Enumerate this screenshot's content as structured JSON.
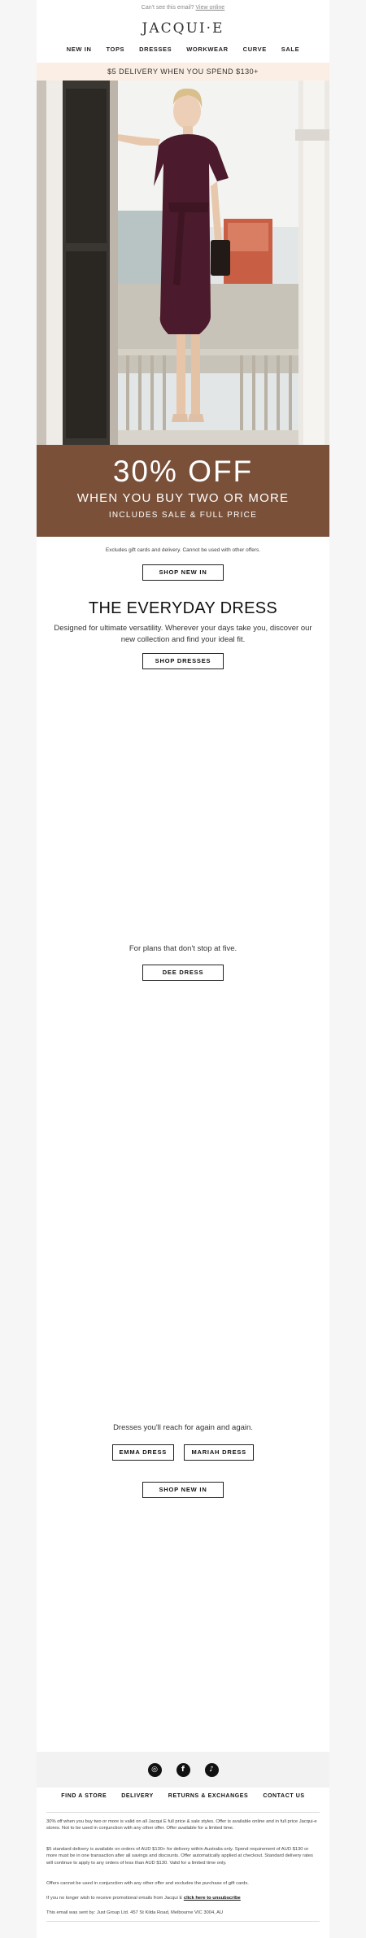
{
  "preheader": {
    "text": "Can't see this email?",
    "link": "View online"
  },
  "brand": {
    "logo": "JACQUI·E"
  },
  "nav": [
    "NEW IN",
    "TOPS",
    "DRESSES",
    "WORKWEAR",
    "CURVE",
    "SALE"
  ],
  "promo_bar": "$5 DELIVERY WHEN YOU SPEND $130+",
  "offer": {
    "headline": "30% OFF",
    "sub": "WHEN YOU BUY TWO OR MORE",
    "small": "INCLUDES SALE & FULL PRICE",
    "note": "Excludes gift cards and delivery. Cannot be used with other offers.",
    "cta": "SHOP NEW IN"
  },
  "everyday": {
    "title": "THE EVERYDAY DRESS",
    "body": "Designed for ultimate versatility. Wherever your days take you, discover our new collection and find your ideal fit.",
    "cta": "SHOP DRESSES"
  },
  "dee": {
    "tagline": "For plans that don't stop at five.",
    "cta": "DEE DRESS"
  },
  "emma": {
    "tagline": "Dresses you'll reach for again and again.",
    "cta_left": "EMMA DRESS",
    "cta_right": "MARIAH DRESS",
    "cta_bottom": "SHOP NEW IN"
  },
  "social": [
    {
      "icon": "instagram-icon",
      "glyph": "◎"
    },
    {
      "icon": "facebook-icon",
      "glyph": "f"
    },
    {
      "icon": "tiktok-icon",
      "glyph": "♪"
    }
  ],
  "footer_nav": [
    "FIND A STORE",
    "DELIVERY",
    "RETURNS & EXCHANGES",
    "CONTACT US"
  ],
  "legal": {
    "p1": "30% off when you buy two or more is valid on all Jacqui E full price & sale styles. Offer is available online and in full price Jacqui-e stores. Not to be used in conjunction with any other offer. Offer available for a limited time.",
    "p2": "$5 standard delivery is available on orders of AUD $130+ for delivery within Australia only. Spend requirement of AUD $130 or more must be in one transaction after all savings and discounts. Offer automatically applied at checkout. Standard delivery rates will continue to apply to any orders of less than AUD $130. Valid for a limited time only.",
    "p3": "Offers cannot be used in conjunction with any other offer and excludes the purchase of gift cards.",
    "unsub_text": "If you no longer wish to receive promotional emails from Jacqui E",
    "unsub_link": "click here to unsubscribe",
    "sent_by": "This email was sent by: Just Group Ltd. 457 St Kilda Road, Melbourne VIC 3004, AU"
  }
}
